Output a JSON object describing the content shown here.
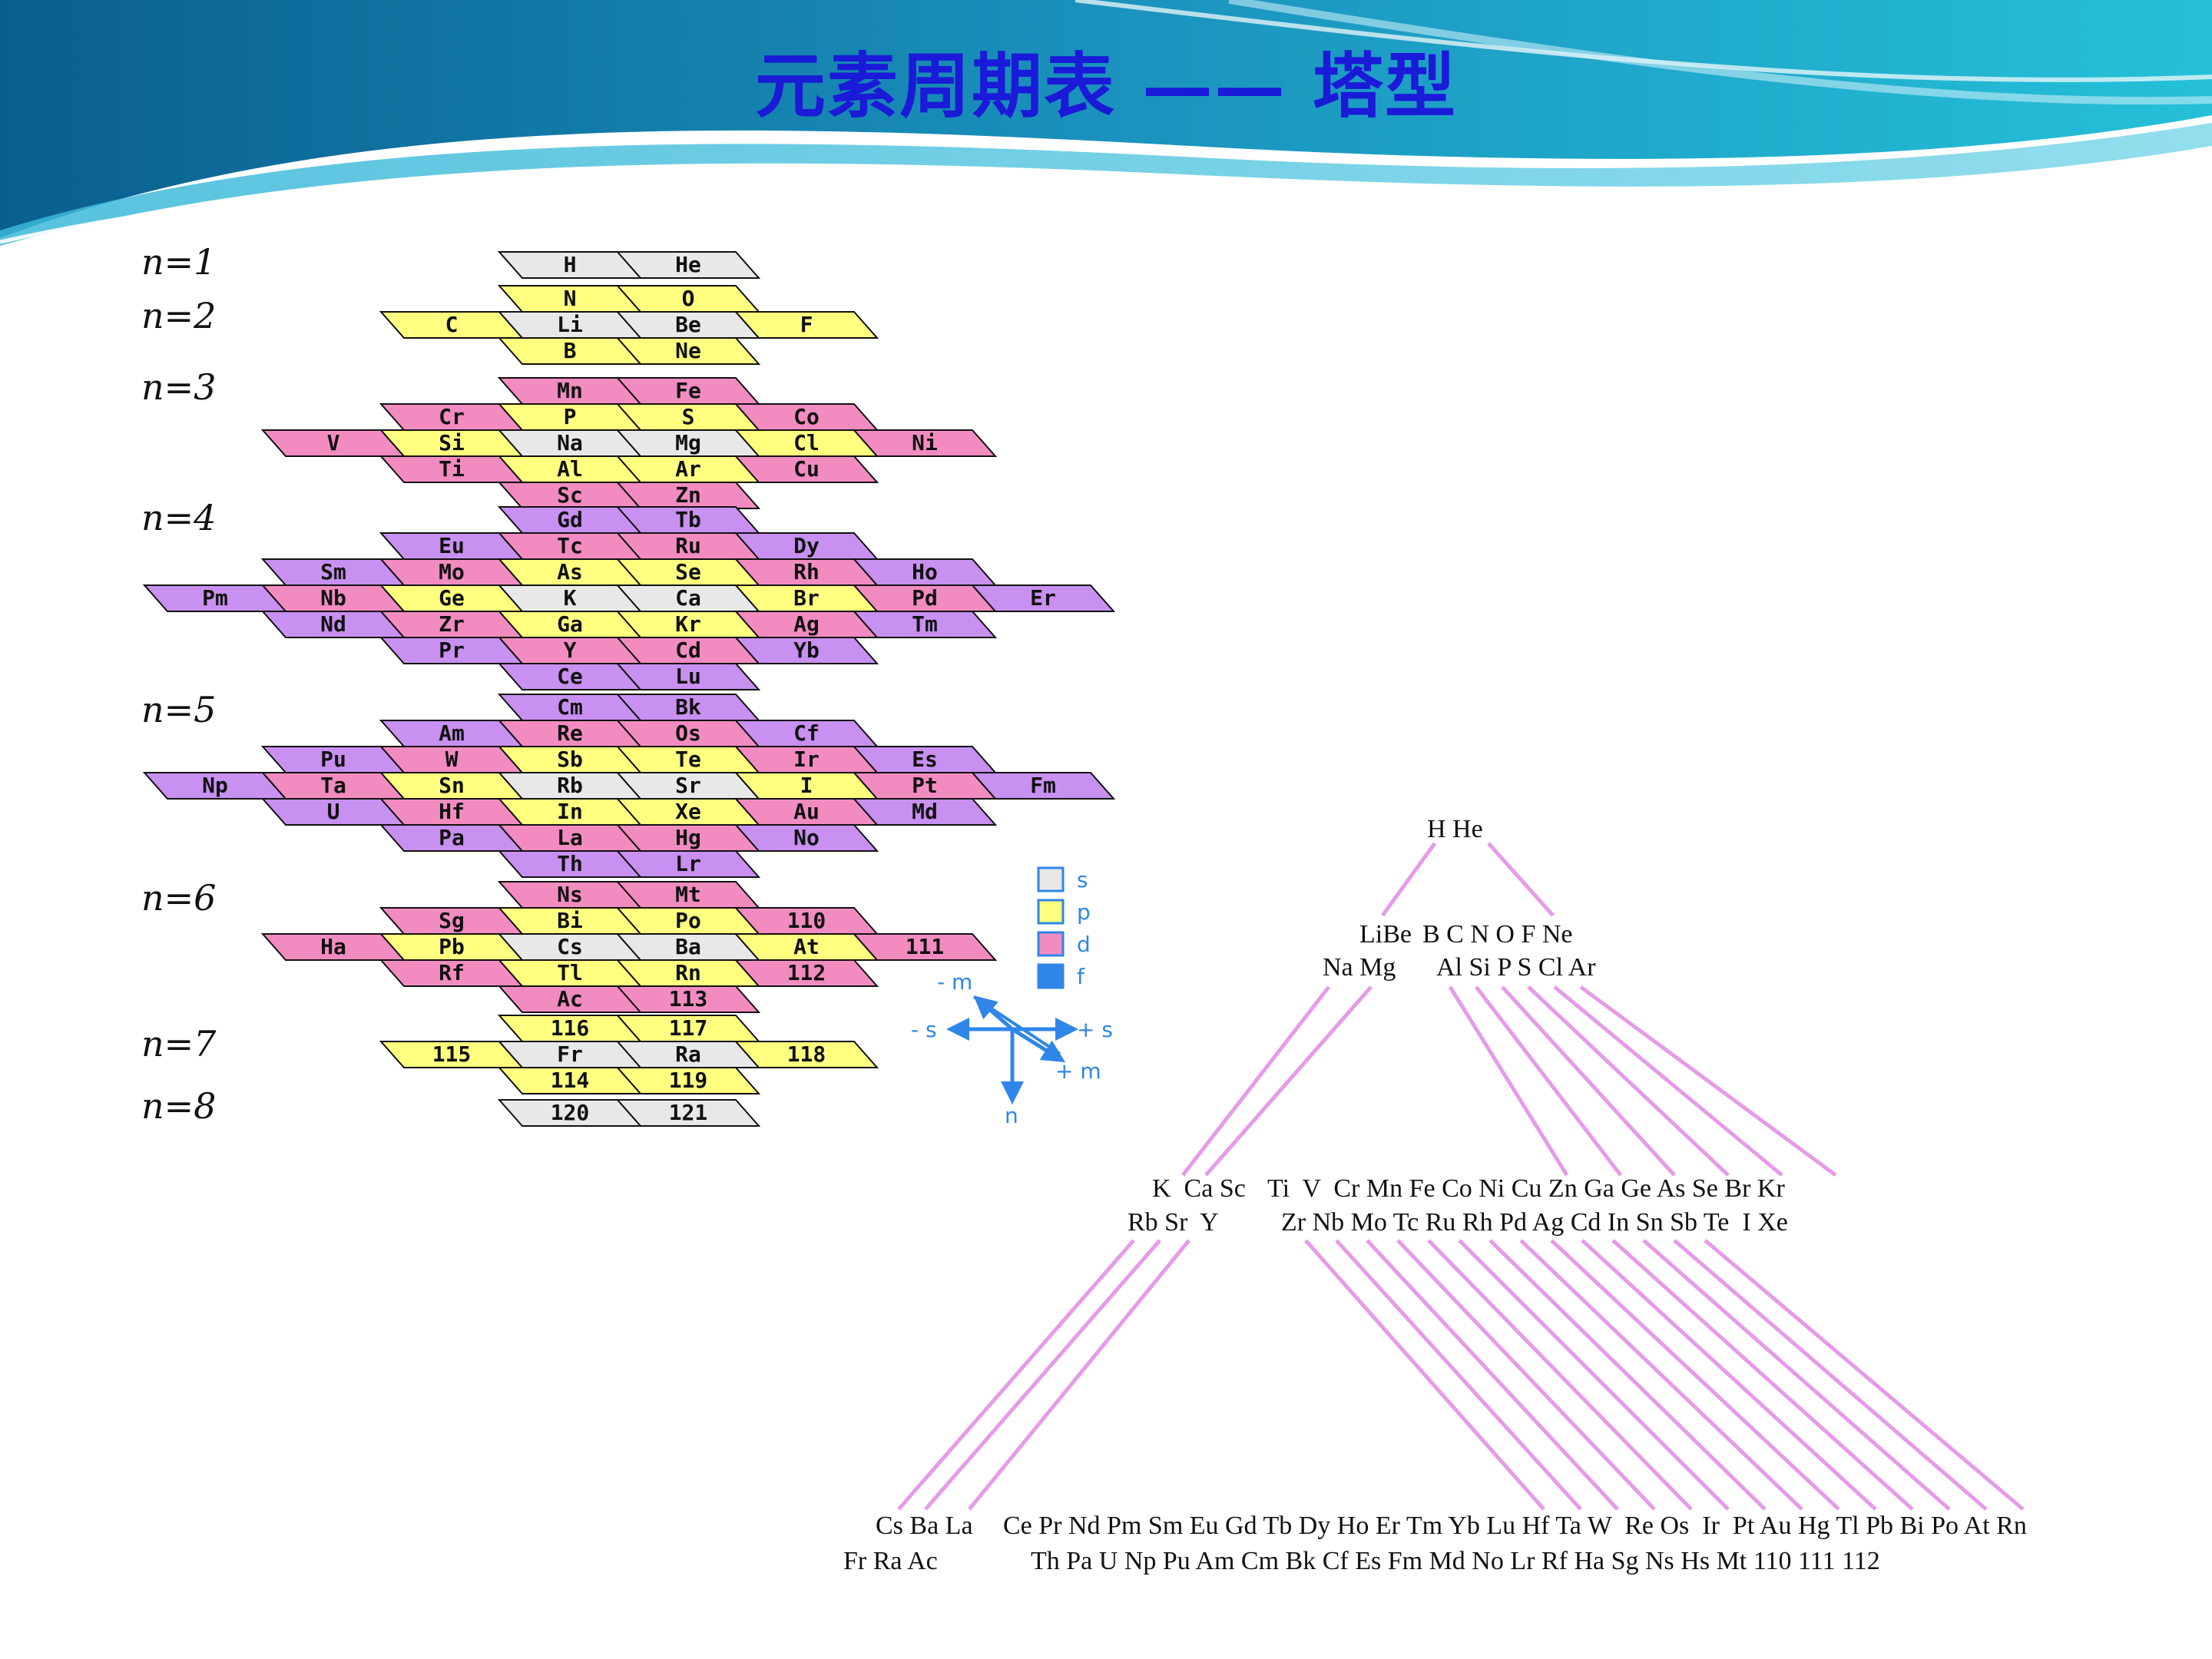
{
  "title": "元素周期表 —— 塔型",
  "colors": {
    "s": "#e8e8e8",
    "p": "#ffff80",
    "d": "#f28cc0",
    "f": "#c890f0",
    "arrow": "#2f86e8",
    "line": "#e59be8",
    "title": "#1a1ad8"
  },
  "shells": [
    {
      "label": "n=1",
      "rows": [
        [
          [
            "H",
            "s"
          ],
          [
            "He",
            "s"
          ]
        ]
      ]
    },
    {
      "label": "n=2",
      "rows": [
        [
          [
            "N",
            "p"
          ],
          [
            "O",
            "p"
          ]
        ],
        [
          [
            "C",
            "p"
          ],
          [
            "Li",
            "s"
          ],
          [
            "Be",
            "s"
          ],
          [
            "F",
            "p"
          ]
        ],
        [
          [
            "B",
            "p"
          ],
          [
            "Ne",
            "p"
          ]
        ]
      ]
    },
    {
      "label": "n=3",
      "rows": [
        [
          [
            "Mn",
            "d"
          ],
          [
            "Fe",
            "d"
          ]
        ],
        [
          [
            "Cr",
            "d"
          ],
          [
            "P",
            "p"
          ],
          [
            "S",
            "p"
          ],
          [
            "Co",
            "d"
          ]
        ],
        [
          [
            "V",
            "d"
          ],
          [
            "Si",
            "p"
          ],
          [
            "Na",
            "s"
          ],
          [
            "Mg",
            "s"
          ],
          [
            "Cl",
            "p"
          ],
          [
            "Ni",
            "d"
          ]
        ],
        [
          [
            "Ti",
            "d"
          ],
          [
            "Al",
            "p"
          ],
          [
            "Ar",
            "p"
          ],
          [
            "Cu",
            "d"
          ]
        ],
        [
          [
            "Sc",
            "d"
          ],
          [
            "Zn",
            "d"
          ]
        ]
      ]
    },
    {
      "label": "n=4",
      "rows": [
        [
          [
            "Gd",
            "f"
          ],
          [
            "Tb",
            "f"
          ]
        ],
        [
          [
            "Eu",
            "f"
          ],
          [
            "Tc",
            "d"
          ],
          [
            "Ru",
            "d"
          ],
          [
            "Dy",
            "f"
          ]
        ],
        [
          [
            "Sm",
            "f"
          ],
          [
            "Mo",
            "d"
          ],
          [
            "As",
            "p"
          ],
          [
            "Se",
            "p"
          ],
          [
            "Rh",
            "d"
          ],
          [
            "Ho",
            "f"
          ]
        ],
        [
          [
            "Pm",
            "f"
          ],
          [
            "Nb",
            "d"
          ],
          [
            "Ge",
            "p"
          ],
          [
            "K",
            "s"
          ],
          [
            "Ca",
            "s"
          ],
          [
            "Br",
            "p"
          ],
          [
            "Pd",
            "d"
          ],
          [
            "Er",
            "f"
          ]
        ],
        [
          [
            "Nd",
            "f"
          ],
          [
            "Zr",
            "d"
          ],
          [
            "Ga",
            "p"
          ],
          [
            "Kr",
            "p"
          ],
          [
            "Ag",
            "d"
          ],
          [
            "Tm",
            "f"
          ]
        ],
        [
          [
            "Pr",
            "f"
          ],
          [
            "Y",
            "d"
          ],
          [
            "Cd",
            "d"
          ],
          [
            "Yb",
            "f"
          ]
        ],
        [
          [
            "Ce",
            "f"
          ],
          [
            "Lu",
            "f"
          ]
        ]
      ]
    },
    {
      "label": "n=5",
      "rows": [
        [
          [
            "Cm",
            "f"
          ],
          [
            "Bk",
            "f"
          ]
        ],
        [
          [
            "Am",
            "f"
          ],
          [
            "Re",
            "d"
          ],
          [
            "Os",
            "d"
          ],
          [
            "Cf",
            "f"
          ]
        ],
        [
          [
            "Pu",
            "f"
          ],
          [
            "W",
            "d"
          ],
          [
            "Sb",
            "p"
          ],
          [
            "Te",
            "p"
          ],
          [
            "Ir",
            "d"
          ],
          [
            "Es",
            "f"
          ]
        ],
        [
          [
            "Np",
            "f"
          ],
          [
            "Ta",
            "d"
          ],
          [
            "Sn",
            "p"
          ],
          [
            "Rb",
            "s"
          ],
          [
            "Sr",
            "s"
          ],
          [
            "I",
            "p"
          ],
          [
            "Pt",
            "d"
          ],
          [
            "Fm",
            "f"
          ]
        ],
        [
          [
            "U",
            "f"
          ],
          [
            "Hf",
            "d"
          ],
          [
            "In",
            "p"
          ],
          [
            "Xe",
            "p"
          ],
          [
            "Au",
            "d"
          ],
          [
            "Md",
            "f"
          ]
        ],
        [
          [
            "Pa",
            "f"
          ],
          [
            "La",
            "d"
          ],
          [
            "Hg",
            "d"
          ],
          [
            "No",
            "f"
          ]
        ],
        [
          [
            "Th",
            "f"
          ],
          [
            "Lr",
            "f"
          ]
        ]
      ]
    },
    {
      "label": "n=6",
      "rows": [
        [
          [
            "Ns",
            "d"
          ],
          [
            "Mt",
            "d"
          ]
        ],
        [
          [
            "Sg",
            "d"
          ],
          [
            "Bi",
            "p"
          ],
          [
            "Po",
            "p"
          ],
          [
            "110",
            "d"
          ]
        ],
        [
          [
            "Ha",
            "d"
          ],
          [
            "Pb",
            "p"
          ],
          [
            "Cs",
            "s"
          ],
          [
            "Ba",
            "s"
          ],
          [
            "At",
            "p"
          ],
          [
            "111",
            "d"
          ]
        ],
        [
          [
            "Rf",
            "d"
          ],
          [
            "Tl",
            "p"
          ],
          [
            "Rn",
            "p"
          ],
          [
            "112",
            "d"
          ]
        ],
        [
          [
            "Ac",
            "d"
          ],
          [
            "113",
            "d"
          ]
        ]
      ]
    },
    {
      "label": "n=7",
      "rows": [
        [
          [
            "116",
            "p"
          ],
          [
            "117",
            "p"
          ]
        ],
        [
          [
            "115",
            "p"
          ],
          [
            "Fr",
            "s"
          ],
          [
            "Ra",
            "s"
          ],
          [
            "118",
            "p"
          ]
        ],
        [
          [
            "114",
            "p"
          ],
          [
            "119",
            "p"
          ]
        ]
      ]
    },
    {
      "label": "n=8",
      "rows": [
        [
          [
            "120",
            "s"
          ],
          [
            "121",
            "s"
          ]
        ]
      ]
    }
  ],
  "legend": [
    {
      "label": "s",
      "type": "s"
    },
    {
      "label": "p",
      "type": "p"
    },
    {
      "label": "d",
      "type": "d"
    },
    {
      "label": "f",
      "type": "f"
    }
  ],
  "axes": {
    "minus_m": "- m",
    "minus_s": "- s",
    "plus_s": "+ s",
    "plus_m": "+ m",
    "n": "n"
  },
  "pyramid": {
    "level1": {
      "row1": "H He"
    },
    "level2": {
      "row1_left": "LiBe",
      "row1_right": "B C N O F Ne",
      "row2_left": "Na Mg",
      "row2_right": "Al Si P S Cl Ar"
    },
    "level3": {
      "row1_left": "K  Ca Sc",
      "row1_right": "Ti  V  Cr Mn Fe Co Ni Cu Zn Ga Ge As Se Br Kr",
      "row2_left": "Rb Sr  Y",
      "row2_right": "Zr Nb Mo Tc Ru Rh Pd Ag Cd In Sn Sb Te  I Xe"
    },
    "level4": {
      "row1_left": "Cs Ba La",
      "row1_right": "Ce Pr Nd Pm Sm Eu Gd Tb Dy Ho Er Tm Yb Lu Hf Ta W  Re Os  Ir  Pt Au Hg Tl Pb Bi Po At Rn",
      "row2_left": "Fr Ra Ac",
      "row2_right": "Th Pa U Np Pu Am Cm Bk Cf Es Fm Md No Lr Rf Ha Sg Ns Hs Mt 110 111 112"
    }
  }
}
